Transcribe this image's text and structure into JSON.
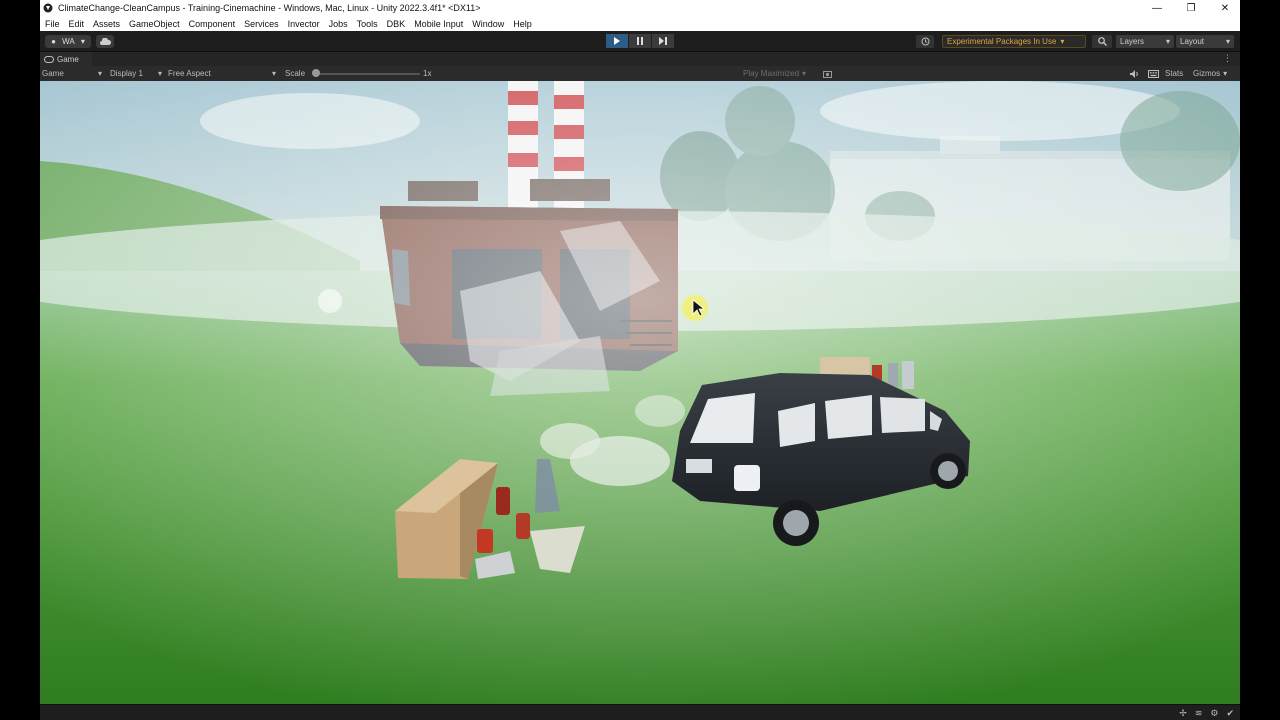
{
  "window": {
    "title": "ClimateChange-CleanCampus - Training-Cinemachine - Windows, Mac, Linux - Unity 2022.3.4f1* <DX11>",
    "controls": {
      "minimize": "—",
      "restore": "❐",
      "close": "✕"
    }
  },
  "menu": [
    "File",
    "Edit",
    "Assets",
    "GameObject",
    "Component",
    "Services",
    "Invector",
    "Jobs",
    "Tools",
    "DBK",
    "Mobile Input",
    "Window",
    "Help"
  ],
  "toolbar": {
    "account_label": "WA",
    "experimental_label": "Experimental Packages In Use",
    "layers_label": "Layers",
    "layout_label": "Layout",
    "play_state": "playing"
  },
  "tab": {
    "label": "Game"
  },
  "game_toolbar": {
    "view_mode": "Game",
    "display": "Display 1",
    "aspect": "Free Aspect",
    "scale_label": "Scale",
    "scale_value": "1x",
    "scale_fraction": 0.0,
    "play_mode": "Play Maximized",
    "stats_label": "Stats",
    "gizmos_label": "Gizmos"
  },
  "colors": {
    "play_active": "#2f5c87",
    "warning_text": "#e1a340",
    "editor_bg": "#191919"
  }
}
